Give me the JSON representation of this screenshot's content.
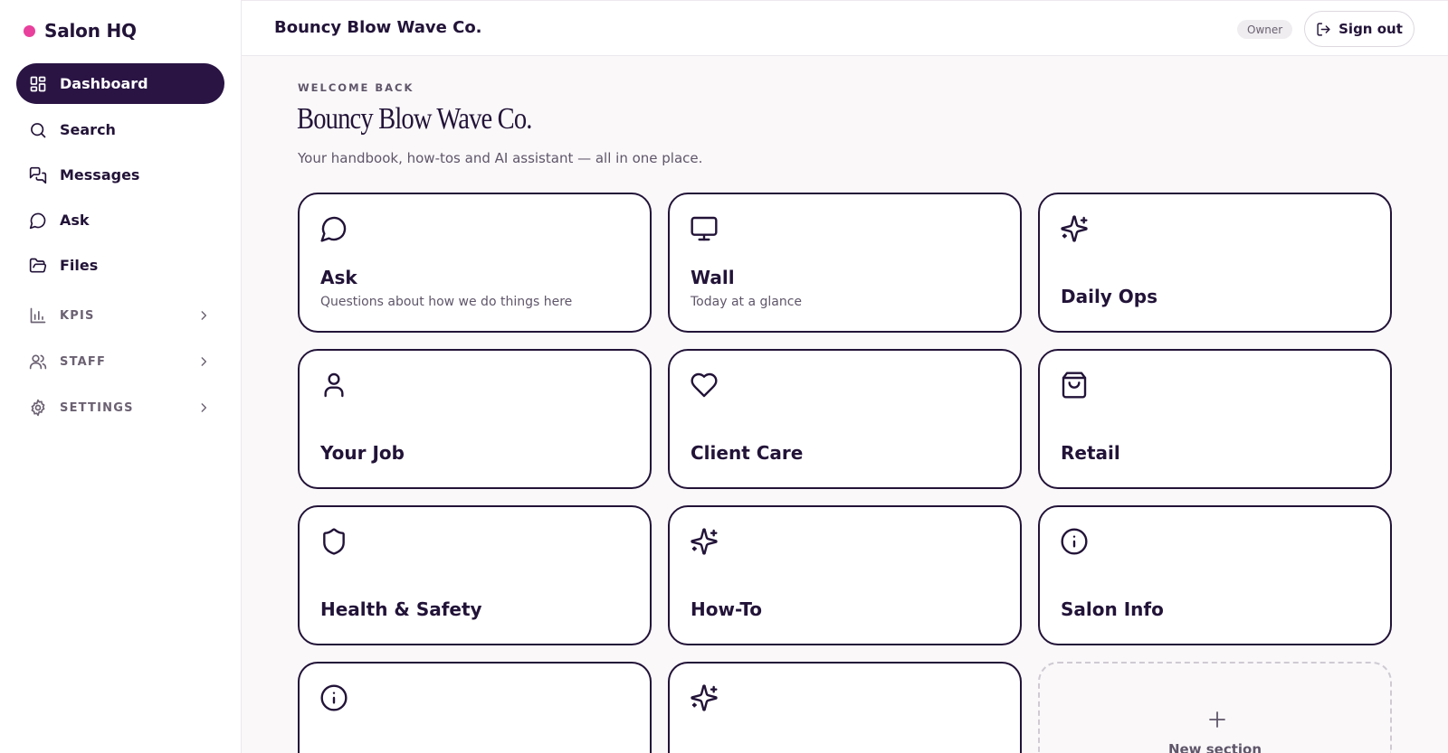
{
  "sidebar": {
    "brand": "Salon HQ",
    "brand_color": "#e8409c",
    "items": [
      {
        "label": "Dashboard",
        "icon": "dashboard-grid-icon",
        "active": true
      },
      {
        "label": "Search",
        "icon": "search-icon"
      },
      {
        "label": "Messages",
        "icon": "messages-icon"
      },
      {
        "label": "Ask",
        "icon": "chat-bubble-icon"
      },
      {
        "label": "Files",
        "icon": "folder-open-icon"
      }
    ],
    "groups": [
      {
        "label": "KPIS",
        "icon": "bar-chart-icon"
      },
      {
        "label": "STAFF",
        "icon": "users-icon"
      },
      {
        "label": "SETTINGS",
        "icon": "gear-icon"
      }
    ]
  },
  "topbar": {
    "title": "Bouncy Blow Wave Co.",
    "role": "Owner",
    "signout_label": "Sign out"
  },
  "welcome": {
    "kicker": "WELCOME BACK",
    "title": "Bouncy Blow Wave Co.",
    "subtitle": "Your handbook, how-tos and AI assistant — all in one place."
  },
  "cards": [
    {
      "title": "Ask",
      "subtitle": "Questions about how we do things here",
      "icon": "chat-bubble-icon"
    },
    {
      "title": "Wall",
      "subtitle": "Today at a glance",
      "icon": "monitor-icon"
    },
    {
      "title": "Daily Ops",
      "icon": "sparkles-icon"
    },
    {
      "title": "Your Job",
      "icon": "user-icon"
    },
    {
      "title": "Client Care",
      "icon": "heart-icon"
    },
    {
      "title": "Retail",
      "icon": "shopping-bag-icon"
    },
    {
      "title": "Health & Safety",
      "icon": "shield-icon"
    },
    {
      "title": "How-To",
      "icon": "sparkles-icon"
    },
    {
      "title": "Salon Info",
      "icon": "info-icon"
    },
    {
      "title": "",
      "icon": "info-icon"
    },
    {
      "title": "",
      "icon": "sparkles-icon"
    }
  ],
  "new_section_label": "New section",
  "colors": {
    "primary": "#221338",
    "active_nav": "#2a1444",
    "muted": "#5f566a",
    "background": "#faf8f9"
  }
}
